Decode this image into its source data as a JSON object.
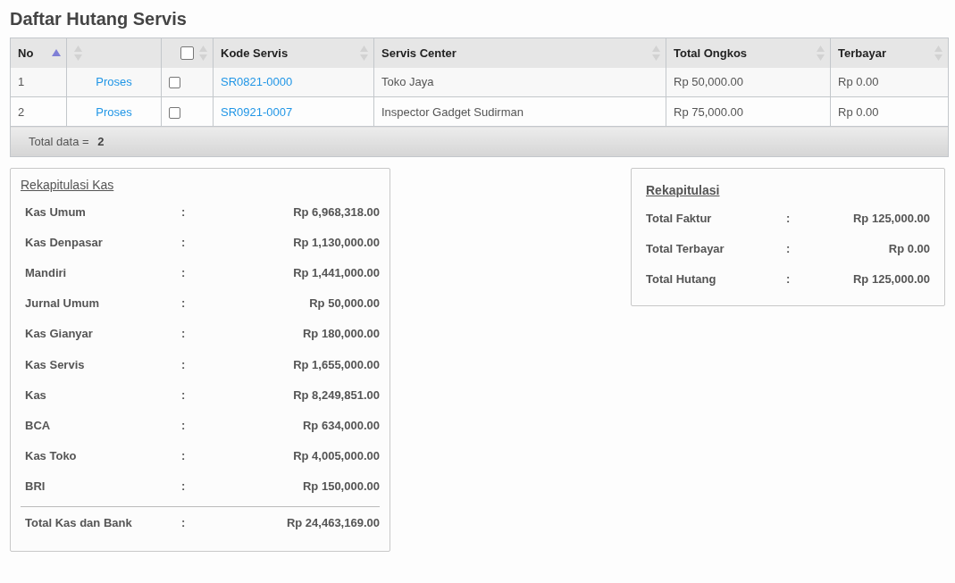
{
  "title": "Daftar Hutang Servis",
  "table": {
    "columns": [
      {
        "kind": "text",
        "label": "No",
        "sorted": true
      },
      {
        "kind": "text",
        "sorted": false
      },
      {
        "kind": "checkbox",
        "checked": false,
        "sorted": false
      },
      {
        "kind": "text",
        "label": "Kode Servis",
        "sorted": false
      },
      {
        "kind": "text",
        "label": "Servis Center",
        "sorted": false
      },
      {
        "kind": "text",
        "label": "Total Ongkos",
        "sorted": false
      },
      {
        "kind": "text",
        "label": "Terbayar",
        "sorted": false
      }
    ],
    "rows": [
      {
        "no": "1",
        "action": "Proses",
        "checked": false,
        "kode": "SR0821-0000",
        "center": "Toko Jaya",
        "total": "Rp 50,000.00",
        "paid": "Rp 0.00"
      },
      {
        "no": "2",
        "action": "Proses",
        "checked": false,
        "kode": "SR0921-0007",
        "center": "Inspector Gadget Sudirman",
        "total": "Rp 75,000.00",
        "paid": "Rp 0.00"
      }
    ],
    "footer": {
      "label": "Total data =",
      "value": "2"
    }
  },
  "kas": {
    "title": "Rekapitulasi Kas",
    "rows": [
      {
        "label": "Kas Umum",
        "separator": ":",
        "value": "Rp 6,968,318.00"
      },
      {
        "label": "Kas Denpasar",
        "separator": ":",
        "value": "Rp 1,130,000.00"
      },
      {
        "label": "Mandiri",
        "separator": ":",
        "value": "Rp 1,441,000.00"
      },
      {
        "label": "Jurnal Umum",
        "separator": ":",
        "value": "Rp 50,000.00"
      },
      {
        "label": "Kas Gianyar",
        "separator": ":",
        "value": "Rp 180,000.00"
      },
      {
        "label": "Kas Servis",
        "separator": ":",
        "value": "Rp 1,655,000.00"
      },
      {
        "label": "Kas",
        "separator": ":",
        "value": "Rp 8,249,851.00"
      },
      {
        "label": "BCA",
        "separator": ":",
        "value": "Rp 634,000.00"
      },
      {
        "label": "Kas Toko",
        "separator": ":",
        "value": "Rp 4,005,000.00"
      },
      {
        "label": "BRI",
        "separator": ":",
        "value": "Rp 150,000.00"
      }
    ],
    "total": {
      "label": "Total Kas dan Bank",
      "separator": ":",
      "value": "Rp 24,463,169.00"
    }
  },
  "rekap": {
    "title": "Rekapitulasi",
    "rows": [
      {
        "label": "Total Faktur",
        "separator": ":",
        "value": "Rp 125,000.00"
      },
      {
        "label": "Total Terbayar",
        "separator": ":",
        "value": "Rp 0.00"
      },
      {
        "label": "Total Hutang",
        "separator": ":",
        "value": "Rp 125,000.00"
      }
    ]
  }
}
